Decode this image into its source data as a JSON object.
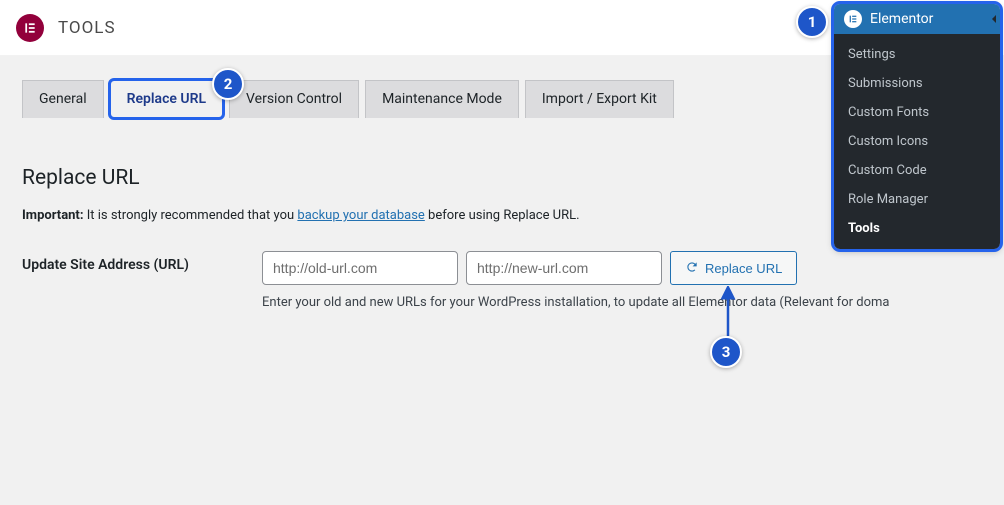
{
  "header": {
    "title": "TOOLS"
  },
  "tabs": [
    {
      "label": "General"
    },
    {
      "label": "Replace URL"
    },
    {
      "label": "Version Control"
    },
    {
      "label": "Maintenance Mode"
    },
    {
      "label": "Import / Export Kit"
    }
  ],
  "section": {
    "title": "Replace URL",
    "important_label": "Important:",
    "important_pre": " It is strongly recommended that you ",
    "important_link": "backup your database",
    "important_post": " before using Replace URL."
  },
  "form": {
    "label": "Update Site Address (URL)",
    "old_placeholder": "http://old-url.com",
    "new_placeholder": "http://new-url.com",
    "button_label": "Replace URL",
    "helper": "Enter your old and new URLs for your WordPress installation, to update all Elementor data (Relevant for doma"
  },
  "flyout": {
    "title": "Elementor",
    "items": [
      "Settings",
      "Submissions",
      "Custom Fonts",
      "Custom Icons",
      "Custom Code",
      "Role Manager",
      "Tools"
    ]
  },
  "steps": {
    "s1": "1",
    "s2": "2",
    "s3": "3"
  }
}
